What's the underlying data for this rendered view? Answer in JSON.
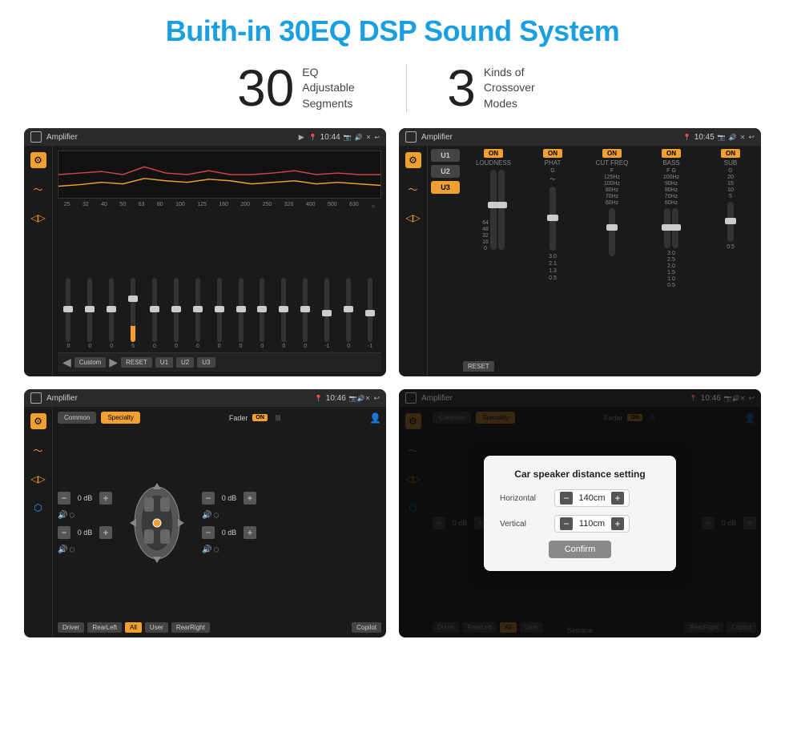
{
  "page": {
    "title": "Buith-in 30EQ DSP Sound System",
    "stats": [
      {
        "number": "30",
        "desc": "EQ Adjustable\nSegments"
      },
      {
        "number": "3",
        "desc": "Kinds of\nCrossover Modes"
      }
    ]
  },
  "screens": {
    "screen1": {
      "status": {
        "title": "Amplifier",
        "time": "10:44"
      },
      "eq_freqs": [
        "25",
        "32",
        "40",
        "50",
        "63",
        "80",
        "100",
        "125",
        "160",
        "200",
        "250",
        "320",
        "400",
        "500",
        "630"
      ],
      "eq_values": [
        "0",
        "0",
        "0",
        "0",
        "5",
        "0",
        "0",
        "0",
        "0",
        "0",
        "0",
        "0",
        "-1",
        "0",
        "-1"
      ],
      "bottom_buttons": [
        "Custom",
        "RESET",
        "U1",
        "U2",
        "U3"
      ]
    },
    "screen2": {
      "status": {
        "title": "Amplifier",
        "time": "10:45"
      },
      "presets": [
        "U1",
        "U2",
        "U3"
      ],
      "active_preset": "U3",
      "channels": [
        {
          "name": "LOUDNESS",
          "on": true
        },
        {
          "name": "PHAT",
          "on": true
        },
        {
          "name": "CUT FREQ",
          "on": true
        },
        {
          "name": "BASS",
          "on": true
        },
        {
          "name": "SUB",
          "on": true
        }
      ],
      "reset_label": "RESET"
    },
    "screen3": {
      "status": {
        "title": "Amplifier",
        "time": "10:46"
      },
      "modes": [
        "Common",
        "Specialty"
      ],
      "active_mode": "Specialty",
      "fader_label": "Fader",
      "on_badge": "ON",
      "vol_labels": [
        "0 dB",
        "0 dB",
        "0 dB",
        "0 dB"
      ],
      "bottom_buttons": [
        "Driver",
        "RearLeft",
        "All",
        "User",
        "RearRight",
        "Copilot"
      ]
    },
    "screen4": {
      "status": {
        "title": "Amplifier",
        "time": "10:46"
      },
      "modes": [
        "Common",
        "Specialty"
      ],
      "dialog": {
        "title": "Car speaker distance setting",
        "rows": [
          {
            "label": "Horizontal",
            "value": "140cm"
          },
          {
            "label": "Vertical",
            "value": "110cm"
          }
        ],
        "confirm_label": "Confirm"
      },
      "vol_labels": [
        "0 dB",
        "0 dB"
      ],
      "bottom_buttons": [
        "Driver",
        "RearLeft",
        "All",
        "User",
        "RearRight",
        "Copilot"
      ]
    }
  },
  "watermark": "Seicane"
}
